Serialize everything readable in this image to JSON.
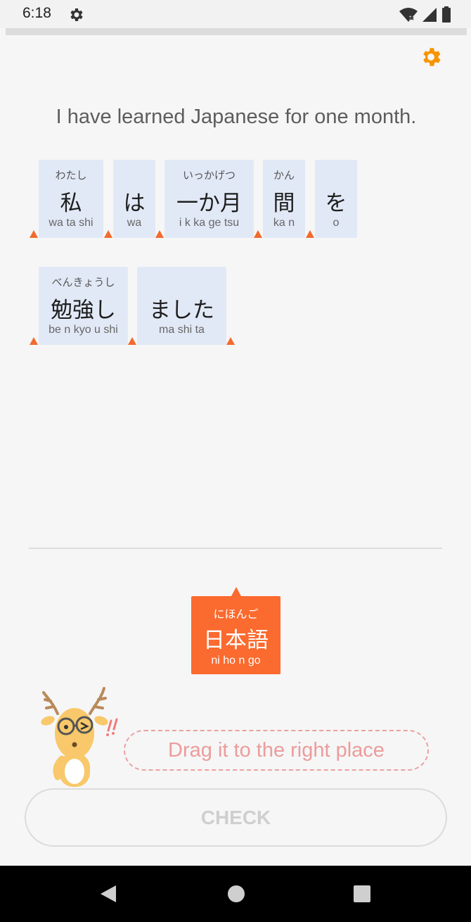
{
  "status_bar": {
    "time": "6:18"
  },
  "sentence": "I have learned Japanese for one month.",
  "answer_tiles": [
    {
      "furigana": "わたし",
      "kanji": "私",
      "romaji": "wa ta shi"
    },
    {
      "furigana": "",
      "kanji": "は",
      "romaji": "wa"
    },
    {
      "furigana": "いっかげつ",
      "kanji": "一か月",
      "romaji": "i k ka ge tsu"
    },
    {
      "furigana": "かん",
      "kanji": "間",
      "romaji": "ka n"
    },
    {
      "furigana": "",
      "kanji": "を",
      "romaji": "o"
    },
    {
      "furigana": "べんきょうし",
      "kanji": "勉強し",
      "romaji": "be n kyo u shi"
    },
    {
      "furigana": "",
      "kanji": "ました",
      "romaji": "ma shi ta"
    }
  ],
  "drag_tile": {
    "furigana": "にほんご",
    "kanji": "日本語",
    "romaji": "ni ho n go"
  },
  "hint": "Drag it to the right place",
  "check_label": "CHECK",
  "colors": {
    "accent_orange": "#fb6a2e",
    "settings_gear": "#f89400",
    "tile_background": "#e2e9f6",
    "hint_pink": "#ec9c9c"
  },
  "icons": {
    "status": [
      "settings-gear-icon",
      "wifi-icon",
      "cellular-signal-icon",
      "battery-icon"
    ],
    "app_settings": "gear-icon",
    "navigation": [
      "back-icon",
      "home-icon",
      "recents-icon"
    ]
  }
}
